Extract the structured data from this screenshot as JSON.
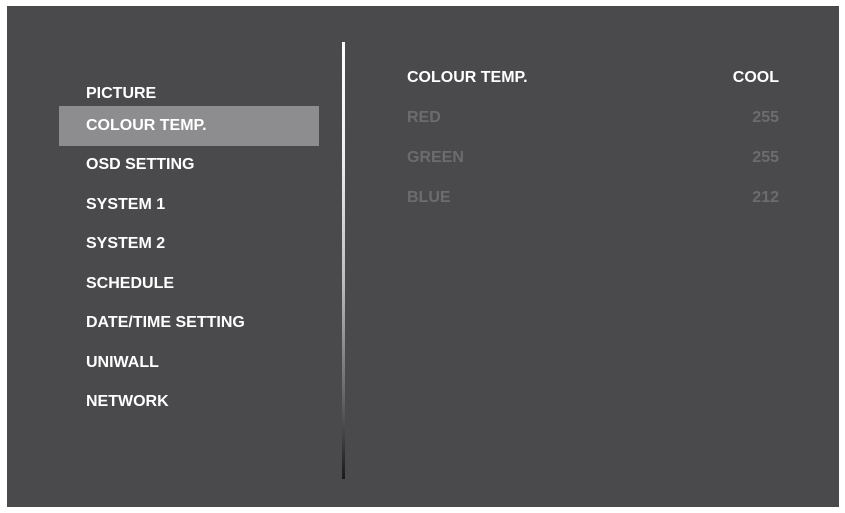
{
  "menu": {
    "items": [
      {
        "label": "PICTURE"
      },
      {
        "label": "COLOUR TEMP."
      },
      {
        "label": "OSD SETTING"
      },
      {
        "label": "SYSTEM 1"
      },
      {
        "label": "SYSTEM 2"
      },
      {
        "label": "SCHEDULE"
      },
      {
        "label": "DATE/TIME SETTING"
      },
      {
        "label": "UNIWALL"
      },
      {
        "label": "NETWORK"
      }
    ],
    "selected_label": "COLOUR TEMP."
  },
  "detail": {
    "rows": [
      {
        "label": "COLOUR TEMP.",
        "value": "COOL"
      },
      {
        "label": "RED",
        "value": "255"
      },
      {
        "label": "GREEN",
        "value": "255"
      },
      {
        "label": "BLUE",
        "value": "212"
      }
    ]
  },
  "colors": {
    "background": "#4a4a4c",
    "selected_highlight": "#8d8d8f",
    "text_active": "#ffffff",
    "text_disabled": "#6c6c6e"
  }
}
